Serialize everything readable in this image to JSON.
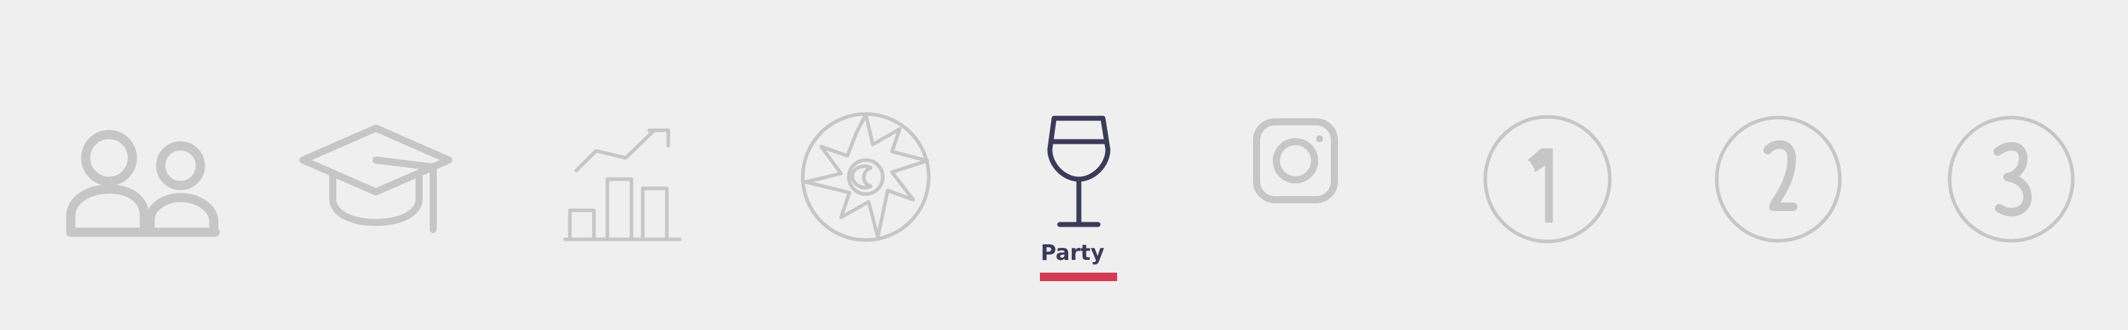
{
  "icons": [
    {
      "name": "team-icon"
    },
    {
      "name": "graduation-cap-icon"
    },
    {
      "name": "growth-chart-icon"
    },
    {
      "name": "compass-icon"
    },
    {
      "name": "wine-glass-icon",
      "label": "Party",
      "active": true
    },
    {
      "name": "instagram-icon"
    },
    {
      "name": "number-one-icon"
    },
    {
      "name": "number-two-icon"
    },
    {
      "name": "number-three-icon"
    }
  ],
  "active_tab": {
    "label": "Party"
  },
  "colors": {
    "inactive": "#c6c6c6",
    "active": "#3b3a58",
    "accent": "#d43b52",
    "background": "#efefef"
  }
}
